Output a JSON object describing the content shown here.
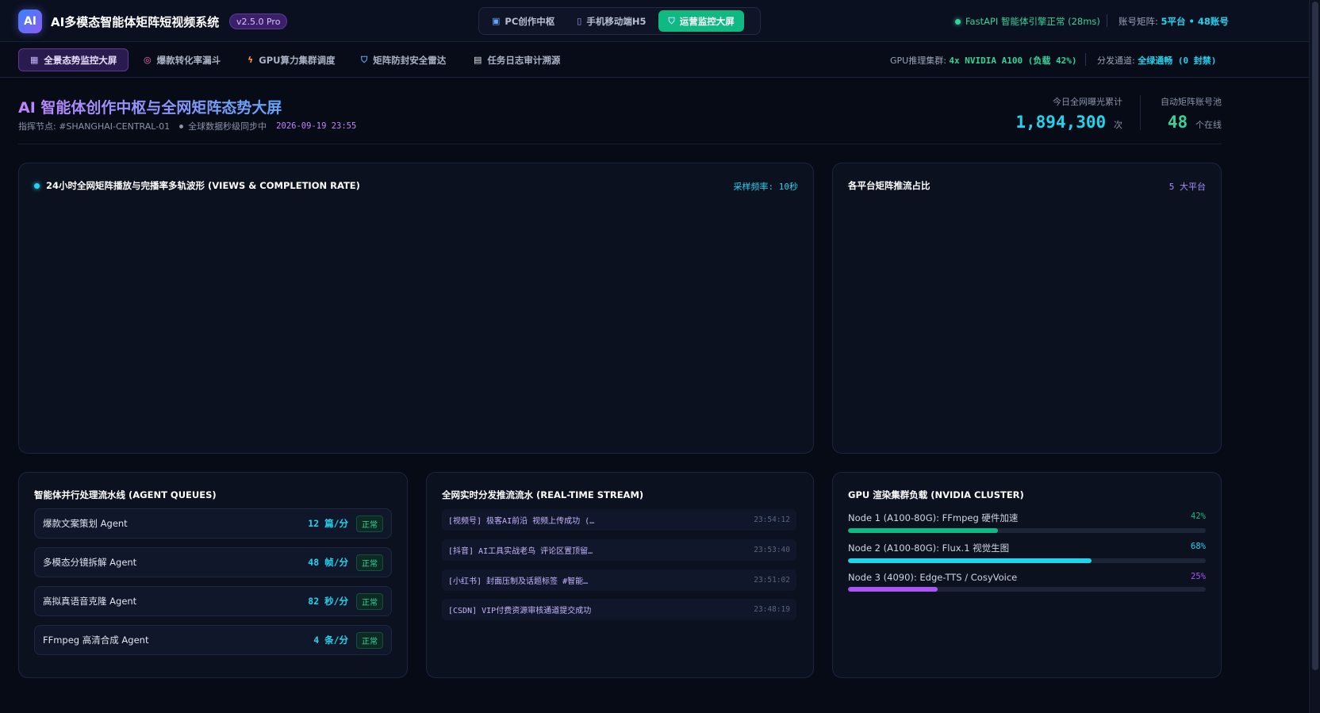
{
  "app": {
    "logo": "AI",
    "title": "AI多模态智能体矩阵短视频系统",
    "version": "v2.5.0 Pro"
  },
  "mode_switch": [
    {
      "label": "PC创作中枢",
      "icon": "monitor-icon",
      "active": false
    },
    {
      "label": "手机移动端H5",
      "icon": "phone-icon",
      "active": false
    },
    {
      "label": "运营监控大屏",
      "icon": "shield-icon",
      "active": true
    }
  ],
  "engine_status": "FastAPI 智能体引擎正常 (28ms)",
  "account_matrix": {
    "label": "账号矩阵:",
    "value": "5平台 • 48账号"
  },
  "nav": [
    {
      "label": "全景态势监控大屏",
      "icon": "chart-icon",
      "active": true
    },
    {
      "label": "爆款转化率漏斗",
      "icon": "target-icon",
      "active": false
    },
    {
      "label": "GPU算力集群调度",
      "icon": "lightning-icon",
      "active": false
    },
    {
      "label": "矩阵防封安全雷达",
      "icon": "shield-icon",
      "active": false
    },
    {
      "label": "任务日志审计溯源",
      "icon": "document-icon",
      "active": false
    }
  ],
  "gpu_cluster": {
    "label": "GPU推理集群:",
    "value": "4x NVIDIA A100 (负载 42%)"
  },
  "channel": {
    "label": "分发通道:",
    "value": "全绿通畅 (0 封禁)"
  },
  "dashboard": {
    "title": "AI 智能体创作中枢与全网矩阵态势大屏",
    "node": "指挥节点: #SHANGHAI-CENTRAL-01",
    "sync": "全球数据秒级同步中",
    "datetime": "2026-09-19 23:55"
  },
  "kpis": {
    "exposure": {
      "label": "今日全网曝光累计",
      "value": "1,894,300",
      "unit": "次"
    },
    "accounts": {
      "label": "自动矩阵账号池",
      "value": "48",
      "unit": "个在线"
    }
  },
  "wave_panel": {
    "title": "24小时全网矩阵播放与完播率多轨波形 (VIEWS & COMPLETION RATE)",
    "meta": "采样频率: 10秒"
  },
  "platform_panel": {
    "title": "各平台矩阵推流占比",
    "meta": "5 大平台"
  },
  "queue_panel": {
    "title": "智能体并行处理流水线 (AGENT QUEUES)",
    "rows": [
      {
        "name": "爆款文案策划 Agent",
        "rate": "12 篇/分",
        "status": "正常"
      },
      {
        "name": "多模态分镜拆解 Agent",
        "rate": "48 帧/分",
        "status": "正常"
      },
      {
        "name": "高拟真语音克隆 Agent",
        "rate": "82 秒/分",
        "status": "正常"
      },
      {
        "name": "FFmpeg 高清合成 Agent",
        "rate": "4 条/分",
        "status": "正常"
      }
    ]
  },
  "stream_panel": {
    "title": "全网实时分发推流流水 (REAL-TIME STREAM)",
    "rows": [
      {
        "text": "[视频号] 极客AI前沿 视频上传成功 (…",
        "time": "23:54:12"
      },
      {
        "text": "[抖音] AI工具实战老鸟 评论区置顶留…",
        "time": "23:53:40"
      },
      {
        "text": "[小红书] 封面压制及话题标签 #智能…",
        "time": "23:51:02"
      },
      {
        "text": "[CSDN] VIP付费资源审核通道提交成功",
        "time": "23:48:19"
      }
    ]
  },
  "gpu_panel": {
    "title": "GPU 渲染集群负载 (NVIDIA CLUSTER)",
    "nodes": [
      {
        "label": "Node 1 (A100-80G): FFmpeg 硬件加速",
        "pct": "42%",
        "load": 0.42,
        "color": "#10b981"
      },
      {
        "label": "Node 2 (A100-80G): Flux.1 视觉生图",
        "pct": "68%",
        "load": 0.68,
        "color": "#22d3ee"
      },
      {
        "label": "Node 3 (4090): Edge-TTS / CosyVoice",
        "pct": "25%",
        "load": 0.25,
        "color": "#a855f7"
      }
    ]
  },
  "colors": {
    "accent_green": "#10b981",
    "accent_cyan": "#22d3ee",
    "accent_purple": "#a78bfa",
    "background": "#070b16"
  }
}
